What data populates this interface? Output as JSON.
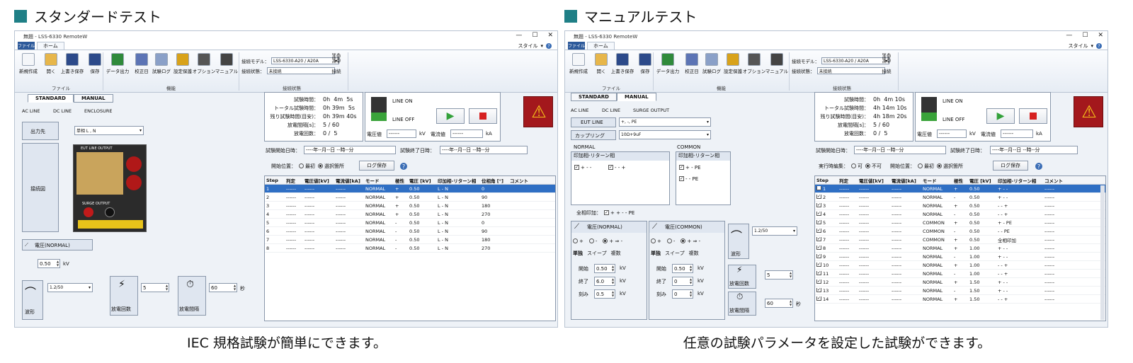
{
  "left_section": {
    "title": "スタンダードテスト",
    "caption": "IEC 規格試験が簡単にできます。"
  },
  "right_section": {
    "title": "マニュアルテスト",
    "caption": "任意の試験パラメータを設定した試験ができます。"
  },
  "accent_color": "#1f7f86",
  "window": {
    "title": "無題 - LSS-6330 RemoteW",
    "minimize": "—",
    "maximize": "☐",
    "close": "✕",
    "file_tab": "ファイル",
    "home_tab": "ホーム",
    "style_label": "スタイル",
    "help": "?"
  },
  "ribbon": {
    "buttons": [
      "新規作成",
      "開く",
      "上書き保存",
      "保存",
      "データ出力",
      "校正日",
      "試験ログ",
      "設定保護",
      "オプション",
      "マニュアル"
    ],
    "group_file": "ファイル",
    "group_func": "機能",
    "group_conn": "接続状態",
    "model_label": "接続モデル：",
    "model_value": "LSS-6330-A20 / A20A",
    "state_label": "接続状態：",
    "state_value": "未接続",
    "connect_label": "接続"
  },
  "status": {
    "test_time_label": "試験時間：",
    "total_time_label": "トータル試験時間：",
    "remain_label": "残り試験時間(目安)：",
    "interval_label": "放電間隔[s]：",
    "count_label": "放電回数：",
    "left": {
      "test_time": "0h  4m  5s",
      "total_time": "0h 39m  5s",
      "remain": "0h 39m 40s",
      "interval": "5 / 60",
      "count": "0 /  5"
    },
    "right": {
      "test_time": "0h  4m 10s",
      "total_time": "4h 14m 10s",
      "remain": "4h 18m 20s",
      "interval": "5 / 60",
      "count": "0 /  5"
    },
    "line_on": "LINE ON",
    "line_off": "LINE OFF",
    "voltage_label": "電圧値",
    "voltage_value": "------",
    "voltage_unit": "kV",
    "current_label": "電流値",
    "current_value": "------",
    "current_unit": "kA",
    "start_dt_label": "試験開始日時：",
    "end_dt_label": "試験終了日時：",
    "dt_value": "----年--月--日 --時--分"
  },
  "controls": {
    "exec_continue_label": "実行時編集：",
    "opt_yes": "可",
    "opt_no": "不可",
    "start_pos_label": "開始位置：",
    "opt_first": "最初",
    "opt_selected": "選択箇所",
    "log_save": "ログ保存"
  },
  "grid_headers": [
    "Step",
    "判定",
    "電圧値[kV]",
    "電流値[kA]",
    "モード",
    "極性",
    "電圧 [kV]",
    "印加相-リターン相",
    "位相角 [°]",
    "コメント"
  ],
  "left_rows": [
    [
      "1",
      "------",
      "------",
      "------",
      "NORMAL",
      "+",
      "0.50",
      "L - N",
      "0",
      ""
    ],
    [
      "2",
      "------",
      "------",
      "------",
      "NORMAL",
      "+",
      "0.50",
      "L - N",
      "90",
      ""
    ],
    [
      "3",
      "------",
      "------",
      "------",
      "NORMAL",
      "+",
      "0.50",
      "L - N",
      "180",
      ""
    ],
    [
      "4",
      "------",
      "------",
      "------",
      "NORMAL",
      "+",
      "0.50",
      "L - N",
      "270",
      ""
    ],
    [
      "5",
      "------",
      "------",
      "------",
      "NORMAL",
      "-",
      "0.50",
      "L - N",
      "0",
      ""
    ],
    [
      "6",
      "------",
      "------",
      "------",
      "NORMAL",
      "-",
      "0.50",
      "L - N",
      "90",
      ""
    ],
    [
      "7",
      "------",
      "------",
      "------",
      "NORMAL",
      "-",
      "0.50",
      "L - N",
      "180",
      ""
    ],
    [
      "8",
      "------",
      "------",
      "------",
      "NORMAL",
      "-",
      "0.50",
      "L - N",
      "270",
      ""
    ]
  ],
  "right_rows": [
    [
      "1",
      "------",
      "------",
      "------",
      "NORMAL",
      "+",
      "0.50",
      "+ - -",
      "------"
    ],
    [
      "2",
      "------",
      "------",
      "------",
      "NORMAL",
      "-",
      "0.50",
      "+ - -",
      "------"
    ],
    [
      "3",
      "------",
      "------",
      "------",
      "NORMAL",
      "+",
      "0.50",
      "- - +",
      "------"
    ],
    [
      "4",
      "------",
      "------",
      "------",
      "NORMAL",
      "-",
      "0.50",
      "- - +",
      "------"
    ],
    [
      "5",
      "------",
      "------",
      "------",
      "COMMON",
      "+",
      "0.50",
      "+ - PE",
      "------"
    ],
    [
      "6",
      "------",
      "------",
      "------",
      "COMMON",
      "-",
      "0.50",
      "- - PE",
      "------"
    ],
    [
      "7",
      "------",
      "------",
      "------",
      "COMMON",
      "+",
      "0.50",
      "全相印加",
      "------"
    ],
    [
      "8",
      "------",
      "------",
      "------",
      "NORMAL",
      "+",
      "1.00",
      "+ - -",
      "------"
    ],
    [
      "9",
      "------",
      "------",
      "------",
      "NORMAL",
      "-",
      "1.00",
      "+ - -",
      "------"
    ],
    [
      "10",
      "------",
      "------",
      "------",
      "NORMAL",
      "+",
      "1.00",
      "- - +",
      "------"
    ],
    [
      "11",
      "------",
      "------",
      "------",
      "NORMAL",
      "-",
      "1.00",
      "- - +",
      "------"
    ],
    [
      "12",
      "------",
      "------",
      "------",
      "NORMAL",
      "+",
      "1.50",
      "+ - -",
      "------"
    ],
    [
      "13",
      "------",
      "------",
      "------",
      "NORMAL",
      "-",
      "1.50",
      "+ - -",
      "------"
    ],
    [
      "14",
      "------",
      "------",
      "------",
      "NORMAL",
      "+",
      "1.50",
      "- - +",
      "------"
    ]
  ],
  "left_settings": {
    "tab_standard": "STANDARD",
    "tab_manual": "MANUAL",
    "sub_ac": "AC LINE",
    "sub_dc": "DC LINE",
    "sub_enc": "ENCLOSURE",
    "output_label": "出力先",
    "output_value": "単相 L , N",
    "wiring_label": "接続図",
    "eut_label": "EUT LINE OUTPUT",
    "surge_label": "SURGE OUTPUT",
    "voltage_normal": "電圧(NORMAL)",
    "voltage_value": "0.50",
    "kv": "kV",
    "waveform_value": "1.2/50",
    "waveform_label": "波形",
    "count_label": "放電回数",
    "count_value": "5",
    "interval_label": "放電間隔",
    "interval_value": "60",
    "sec": "秒"
  },
  "right_settings": {
    "sub_ac": "AC LINE",
    "sub_dc": "DC LINE",
    "sub_surge": "SURGE OUTPUT",
    "eut_line_label": "EUT LINE",
    "eut_line_value": "+, -, PE",
    "coupling_label": "カップリング",
    "coupling_value": "10Ω+9uF",
    "normal_label": "NORMAL",
    "common_label": "COMMON",
    "phase_label": "印加相-リターン相",
    "normal_opts": [
      "+ - -",
      "- - +"
    ],
    "common_opts": [
      "+ - PE",
      "- - PE"
    ],
    "all_phase_label": "全相印加：",
    "all_phase_value": "+ + - - PE",
    "v_normal": "電圧(NORMAL)",
    "v_common": "電圧(COMMON)",
    "pol_plus": "+",
    "pol_minus": "-",
    "pol_both": "+ ⇒ -",
    "mode_single": "単独",
    "mode_sweep": "スイープ",
    "mode_multi": "複数",
    "start_label": "開始",
    "end_label": "終了",
    "step_label": "刻み",
    "n_start": "0.50",
    "n_end": "6.0",
    "n_step": "0.5",
    "c_start": "0.50",
    "c_end": "0",
    "c_step": "0",
    "kv": "kV",
    "waveform_value": "1.2/50",
    "waveform_label": "波形",
    "count_label": "放電回数",
    "count_value": "5",
    "interval_label": "放電間隔",
    "interval_value": "60",
    "sec": "秒"
  }
}
